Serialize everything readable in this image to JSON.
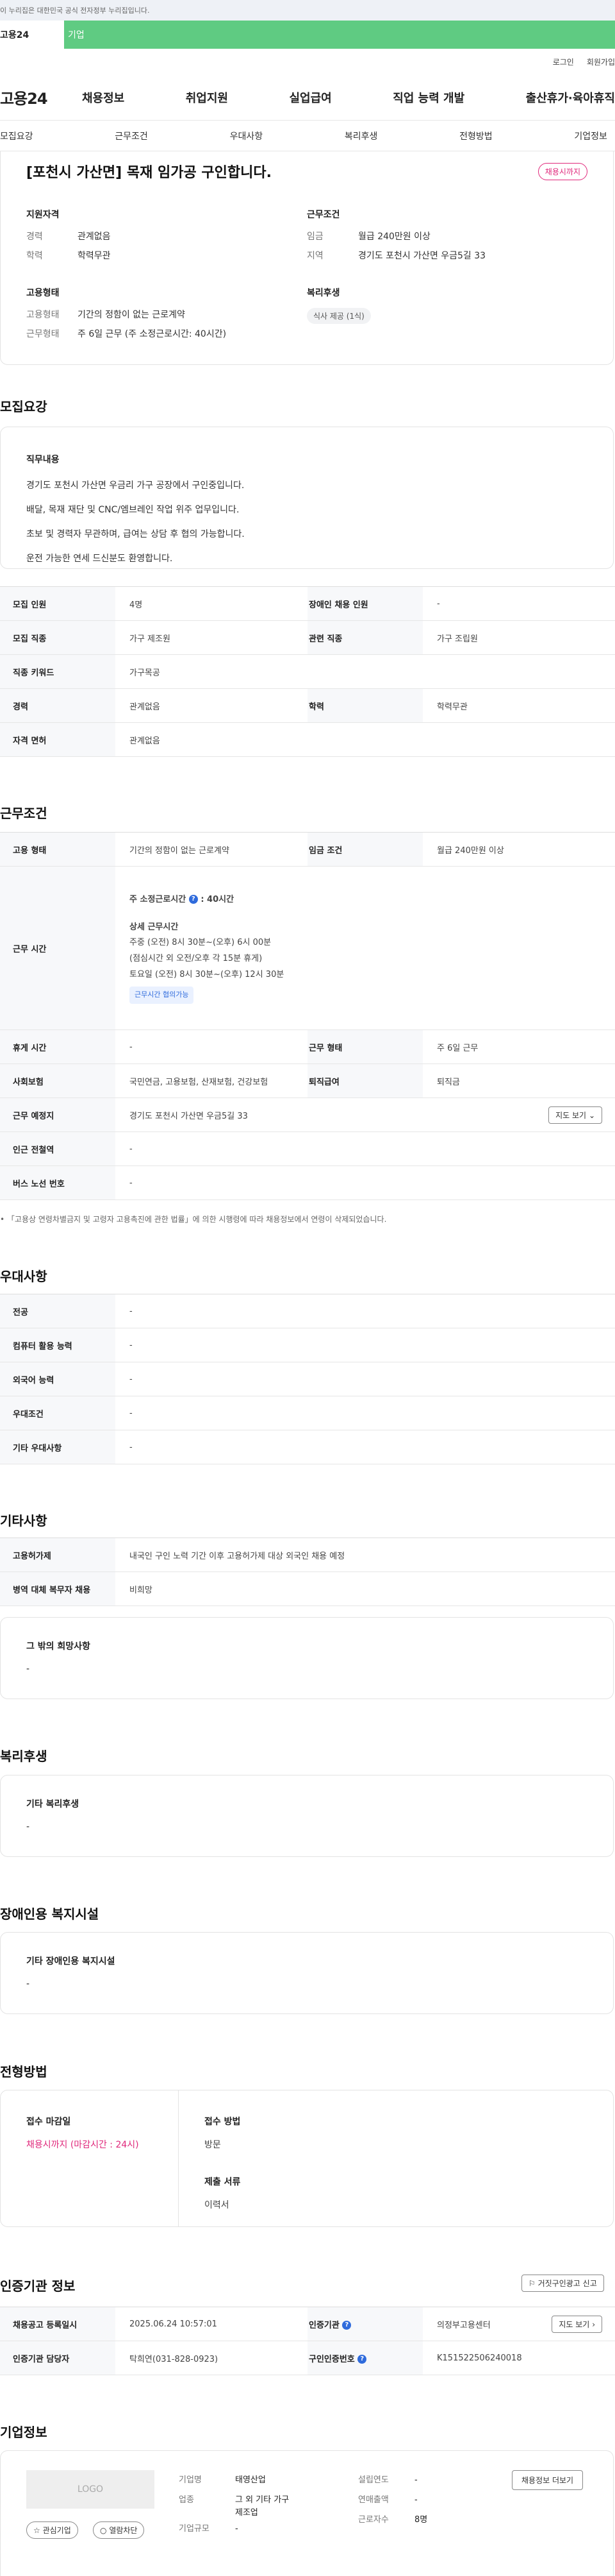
{
  "gov_banner": "이 누리집은 대한민국 공식 전자정부 누리집입니다.",
  "site_strip": {
    "left": "고용24",
    "green": "기업"
  },
  "util": {
    "login": "로그인",
    "join": "회원가입"
  },
  "gnb": {
    "logo": "고용24",
    "menu": [
      "채용정보",
      "취업지원",
      "실업급여",
      "직업 능력 개발",
      "출산휴가·육아휴직"
    ]
  },
  "anchors": [
    "모집요강",
    "근무조건",
    "우대사항",
    "복리후생",
    "전형방법",
    "기업정보"
  ],
  "summary": {
    "title": "[포천시 가산면] 목재 임가공 구인합니다.",
    "badge": "채용시까지",
    "qualify_title": "지원자격",
    "qualify": [
      {
        "k": "경력",
        "v": "관계없음"
      },
      {
        "k": "학력",
        "v": "학력무관"
      }
    ],
    "condition_title": "근무조건",
    "condition": [
      {
        "k": "임금",
        "v": "월급 240만원 이상"
      },
      {
        "k": "지역",
        "v": "경기도 포천시 가산면 우금5길 33"
      }
    ],
    "type_title": "고용형태",
    "type": [
      {
        "k": "고용형태",
        "v": "기간의 정함이 없는 근로계약"
      },
      {
        "k": "근무형태",
        "v": "주 6일 근무 (주 소정근로시간: 40시간)"
      }
    ],
    "welfare_title": "복리후생",
    "welfare_chip": "식사 제공 (1식)"
  },
  "recruit": {
    "title": "모집요강",
    "duty_title": "직무내용",
    "duty_lines": [
      "경기도 포천시 가산면 우금리 가구 공장에서 구인중입니다.",
      "배달, 목재 재단 및 CNC/엠브레인 작업 위주 업무입니다.",
      "초보 및 경력자 무관하며, 급여는 상담 후 협의 가능합니다.",
      "운전 가능한 연세 드신분도 환영합니다."
    ],
    "rows": [
      {
        "k1": "모집 인원",
        "v1": "4명",
        "k2": "장애인 채용 인원",
        "v2": "-"
      },
      {
        "k1": "모집 직종",
        "v1": "가구 제조원",
        "k2": "관련 직종",
        "v2": "가구 조립원"
      },
      {
        "k1": "직종 키워드",
        "v1": "가구목공"
      },
      {
        "k1": "경력",
        "v1": "관계없음",
        "k2": "학력",
        "v2": "학력무관"
      },
      {
        "k1": "자격 면허",
        "v1": "관계없음"
      }
    ]
  },
  "work": {
    "title": "근무조건",
    "row_type": {
      "k1": "고용 형태",
      "v1": "기간의 정함이 없는 근로계약",
      "k2": "임금 조건",
      "v2": "월급 240만원 이상"
    },
    "hours_k": "근무 시간",
    "hours_main": "주 소정근로시간",
    "hours_main_val": ": 40시간",
    "hours_detail_title": "상세 근무시간",
    "hours_detail": [
      "주중 (오전) 8시 30분~(오후) 6시 00분",
      "(점심시간 외 오전/오후 각 15분 휴게)",
      "토요일 (오전) 8시 30분~(오후) 12시 30분"
    ],
    "hours_tag": "근무시간 협의가능",
    "rows": [
      {
        "k1": "휴게 시간",
        "v1": "-",
        "k2": "근무 형태",
        "v2": "주 6일 근무"
      },
      {
        "k1": "사회보험",
        "v1": "국민연금, 고용보험, 산재보험, 건강보험",
        "k2": "퇴직급여",
        "v2": "퇴직금"
      }
    ],
    "location_k": "근무 예정지",
    "location_v": "경기도 포천시 가산면 우금5길 33",
    "map_btn": "지도 보기",
    "rows2": [
      {
        "k1": "인근 전철역",
        "v1": "-"
      },
      {
        "k1": "버스 노선 번호",
        "v1": "-"
      }
    ],
    "note": "「고용상 연령차별금지 및 고령자 고용촉진에 관한 법률」에 의한 시행령에 따라 채용정보에서 연령이 삭제되었습니다."
  },
  "prefer": {
    "title": "우대사항",
    "rows": [
      {
        "k": "전공",
        "v": "-"
      },
      {
        "k": "컴퓨터 활용 능력",
        "v": "-"
      },
      {
        "k": "외국어 능력",
        "v": "-"
      },
      {
        "k": "우대조건",
        "v": "-"
      },
      {
        "k": "기타 우대사항",
        "v": "-"
      }
    ]
  },
  "etc": {
    "title": "기타사항",
    "rows": [
      {
        "k": "고용허가제",
        "v": "내국인 구인 노력 기간 이후 고용허가제 대상 외국인 채용 예정"
      },
      {
        "k": "병역 대체 복무자 채용",
        "v": "비희망"
      }
    ],
    "box_title": "그 밖의 희망사항",
    "box_value": "-"
  },
  "welfare": {
    "title": "복리후생",
    "box_title": "기타 복리후생",
    "box_value": "-"
  },
  "disabled": {
    "title": "장애인용 복지시설",
    "box_title": "기타 장애인용 복지시설",
    "box_value": "-"
  },
  "process": {
    "title": "전형방법",
    "deadline_title": "접수 마감일",
    "deadline_value": "채용시까지 (마감시간 : 24시)",
    "method_title": "접수 방법",
    "method_value": "방문",
    "docs_title": "제출 서류",
    "docs_value": "이력서"
  },
  "agency": {
    "title": "인증기관 정보",
    "report_btn": "거짓구인광고 신고",
    "row1": {
      "k1": "채용공고 등록일시",
      "v1": "2025.06.24 10:57:01",
      "k2": "인증기관",
      "v2": "의정부고용센터",
      "btn": "지도 보기"
    },
    "row2": {
      "k1": "인증기관 담당자",
      "v1": "탁희연(031-828-0923)",
      "k2": "구인인증번호",
      "v2": "K151522506240018"
    }
  },
  "company": {
    "title": "기업정보",
    "logo": "LOGO",
    "fav_btn": "관심기업",
    "block_btn": "열람차단",
    "name_k": "기업명",
    "name_v": "태영산업",
    "biz_k": "업종",
    "biz_v1": "그 외 기타 가구",
    "biz_v2": "제조업",
    "size_k": "기업규모",
    "size_v": "-",
    "year_k": "설립연도",
    "year_v": "-",
    "sales_k": "연매출액",
    "sales_v": "-",
    "emp_k": "근로자수",
    "emp_v": "8명",
    "jobs_btn": "채용정보 더보기"
  },
  "colors": {
    "accent_green": "#5fcb82",
    "accent_pink": "#e0287b",
    "accent_blue": "#2f6bdc"
  }
}
